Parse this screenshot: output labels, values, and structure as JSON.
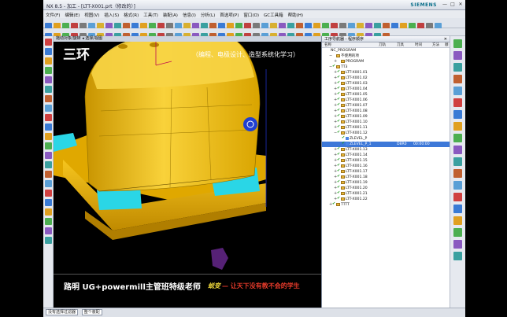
{
  "window": {
    "title": "NX 8.5 - 加工 - [LTT-X001.prt（修改的）]",
    "brand": "SIEMENS",
    "controls": [
      "—",
      "□",
      "✕"
    ]
  },
  "menu": [
    "文件(F)",
    "编辑(E)",
    "视图(V)",
    "插入(S)",
    "格式(R)",
    "工具(T)",
    "装配(A)",
    "信息(I)",
    "分析(L)",
    "首选项(P)",
    "窗口(O)",
    "GC工具箱",
    "帮助(H)"
  ],
  "viewport": {
    "tab_label": "拖动对象/旋转 ◂ 选择/视图",
    "overlay_title": "三环",
    "overlay_subtitle": "（编程、电极设计、造型系统化学习）",
    "overlay_bottom": "路明 UG+powermill主管班特级老师",
    "signature": "蜕变",
    "slogan": "— 让天下没有教不会的学生"
  },
  "navigator": {
    "title": "工序导航器 - 程序顺序",
    "columns": [
      "名称",
      "刀轨",
      "刀具",
      "时间",
      "方法",
      "顺"
    ],
    "rows": [
      {
        "indent": 0,
        "label": "NC_PROGRAM",
        "icon": "none",
        "check": "",
        "expand": ""
      },
      {
        "indent": 1,
        "label": "不使用的项",
        "icon": "folder",
        "check": "",
        "expand": "−"
      },
      {
        "indent": 2,
        "label": "PROGRAM",
        "icon": "folder",
        "check": "",
        "expand": "+"
      },
      {
        "indent": 1,
        "label": "TT3",
        "icon": "folder",
        "check": "✔",
        "expand": "−"
      },
      {
        "indent": 2,
        "label": "LTT-X001.01",
        "icon": "folder",
        "check": "✔",
        "expand": "+"
      },
      {
        "indent": 2,
        "label": "LTT-X001.02",
        "icon": "folder",
        "check": "✔",
        "expand": "+"
      },
      {
        "indent": 2,
        "label": "LTT-X001.03",
        "icon": "folder",
        "check": "✔",
        "expand": "+"
      },
      {
        "indent": 2,
        "label": "LTT-X001.04",
        "icon": "folder",
        "check": "✔",
        "expand": "+"
      },
      {
        "indent": 2,
        "label": "LTT-X001.05",
        "icon": "folder",
        "check": "✔",
        "expand": "+"
      },
      {
        "indent": 2,
        "label": "LTT-X001.06",
        "icon": "folder",
        "check": "✔",
        "expand": "+"
      },
      {
        "indent": 2,
        "label": "LTT-X001.07",
        "icon": "folder",
        "check": "✔",
        "expand": "+"
      },
      {
        "indent": 2,
        "label": "LTT-X001.08",
        "icon": "folder",
        "check": "✔",
        "expand": "+"
      },
      {
        "indent": 2,
        "label": "LTT-X001.09",
        "icon": "folder",
        "check": "✔",
        "expand": "+"
      },
      {
        "indent": 2,
        "label": "LTT-X001.10",
        "icon": "folder",
        "check": "✔",
        "expand": "+"
      },
      {
        "indent": 2,
        "label": "LTT-X001.11",
        "icon": "folder",
        "check": "✔",
        "expand": "+"
      },
      {
        "indent": 2,
        "label": "LTT-X001.12",
        "icon": "folder",
        "check": "✔",
        "expand": "−"
      },
      {
        "indent": 3,
        "label": "ZLEVEL_P",
        "icon": "op",
        "check": "✔",
        "expand": ""
      },
      {
        "indent": 3,
        "label": "ZLEVEL_P_1",
        "icon": "op",
        "check": "✔",
        "expand": "",
        "selected": true,
        "tool": "D8R0",
        "time": "00:00:00"
      },
      {
        "indent": 2,
        "label": "LTT-X001.13",
        "icon": "folder",
        "check": "✔",
        "expand": "+"
      },
      {
        "indent": 2,
        "label": "LTT-X001.14",
        "icon": "folder",
        "check": "✔",
        "expand": "+"
      },
      {
        "indent": 2,
        "label": "LTT-X001.15",
        "icon": "folder",
        "check": "✔",
        "expand": "+"
      },
      {
        "indent": 2,
        "label": "LTT-X001.16",
        "icon": "folder",
        "check": "✔",
        "expand": "+"
      },
      {
        "indent": 2,
        "label": "LTT-X001.17",
        "icon": "folder",
        "check": "✔",
        "expand": "+"
      },
      {
        "indent": 2,
        "label": "LTT-X001.18",
        "icon": "folder",
        "check": "✔",
        "expand": "+"
      },
      {
        "indent": 2,
        "label": "LTT-X001.19",
        "icon": "folder",
        "check": "✔",
        "expand": "+"
      },
      {
        "indent": 2,
        "label": "LTT-X001.20",
        "icon": "folder",
        "check": "✔",
        "expand": "+"
      },
      {
        "indent": 2,
        "label": "LTT-X001.21",
        "icon": "folder",
        "check": "✔",
        "expand": "+"
      },
      {
        "indent": 2,
        "label": "LTT-X001.22",
        "icon": "folder",
        "check": "✔",
        "expand": "+"
      },
      {
        "indent": 1,
        "label": "TTTT",
        "icon": "folder",
        "check": "✔",
        "expand": "+"
      }
    ]
  },
  "statusbar": {
    "filter_label": "没有选择过滤器",
    "assembly_label": "整个装配"
  },
  "colors": {
    "part_yellow": "#f4c20d",
    "cyan_faces": "#2ad6e6",
    "selection_blue": "#3d78d8",
    "folder": "#e9b63a"
  },
  "icons": {
    "left_rail": [
      "assembly-navigator-icon",
      "part-navigator-icon",
      "operation-navigator-icon",
      "roles-icon",
      "history-icon",
      "system-materials-icon",
      "web-browser-icon",
      "palette-icon",
      "layer-icon",
      "measure-icon",
      "analysis-icon",
      "reuse-library-icon",
      "visualization-icon",
      "constraint-icon",
      "hd3d-icon",
      "process-studio-icon",
      "manufacturing-wizard-icon",
      "journal-icon",
      "help-icon",
      "settings-icon",
      "info-icon",
      "scroll-down-icon"
    ],
    "right_rail": [
      "create-program-icon",
      "create-tool-icon",
      "create-geometry-icon",
      "create-method-icon",
      "create-operation-icon",
      "generate-toolpath-icon",
      "verify-toolpath-icon",
      "postprocess-icon",
      "shop-doc-icon",
      "simulate-icon",
      "cut-region-icon",
      "ipw-icon",
      "list-icon",
      "edit-icon",
      "delete-icon",
      "properties-icon",
      "display-icon",
      "hide-icon",
      "scroll-down-icon"
    ]
  }
}
